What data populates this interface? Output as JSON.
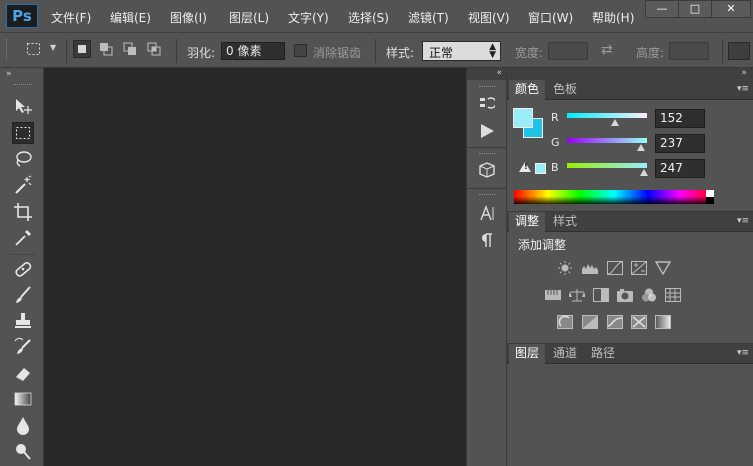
{
  "app": {
    "logo": "Ps"
  },
  "menu": [
    "文件(F)",
    "编辑(E)",
    "图像(I)",
    "图层(L)",
    "文字(Y)",
    "选择(S)",
    "滤镜(T)",
    "视图(V)",
    "窗口(W)",
    "帮助(H)"
  ],
  "window_controls": {
    "minimize": "—",
    "maximize": "□",
    "close": "✕"
  },
  "options": {
    "feather_label": "羽化:",
    "feather_value": "0 像素",
    "antialias_label": "消除锯齿",
    "style_label": "样式:",
    "style_value": "正常",
    "width_label": "宽度:",
    "height_label": "高度:",
    "swap_glyph": "⇄"
  },
  "color_panel": {
    "tabs": [
      "颜色",
      "色板"
    ],
    "channels": [
      {
        "name": "R",
        "value": "152"
      },
      {
        "name": "G",
        "value": "237"
      },
      {
        "name": "B",
        "value": "247"
      }
    ],
    "foreground": "#98EDF7",
    "background": "#1FC3E8"
  },
  "adjust_panel": {
    "tabs": [
      "调整",
      "样式"
    ],
    "heading": "添加调整"
  },
  "layers_panel": {
    "tabs": [
      "图层",
      "通道",
      "路径"
    ]
  },
  "icons": {
    "panel_menu": "▾≡",
    "collapse": "»",
    "collapse_left": "«"
  }
}
